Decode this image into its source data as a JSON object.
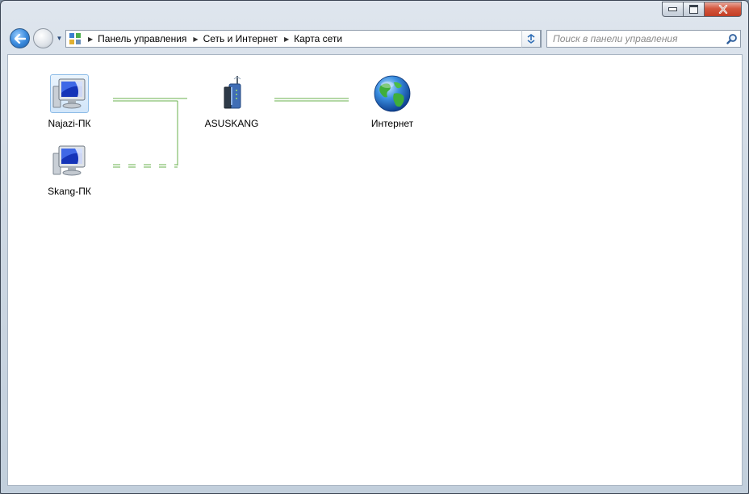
{
  "window": {
    "title": "",
    "buttons": {
      "minimize": "minimize",
      "maximize": "maximize",
      "close": "close"
    }
  },
  "nav": {
    "back_icon": "back-arrow-icon",
    "forward_icon": "forward-arrow-icon",
    "history_icon": "chevron-down-icon"
  },
  "address": {
    "breadcrumbs": [
      "Панель управления",
      "Сеть и Интернет",
      "Карта сети"
    ],
    "refresh_icon": "refresh-icon"
  },
  "search": {
    "placeholder": "Поиск в панели управления",
    "value": ""
  },
  "network_map": {
    "nodes": [
      {
        "label": "Najazi-ПК",
        "type": "computer",
        "selected": true
      },
      {
        "label": "Skang-ПК",
        "type": "computer",
        "selected": false
      },
      {
        "label": "ASUSKANG",
        "type": "router",
        "selected": false
      },
      {
        "label": "Интернет",
        "type": "internet",
        "selected": false
      }
    ],
    "connections": [
      {
        "from": "Najazi-ПК",
        "to": "ASUSKANG",
        "kind": "wired"
      },
      {
        "from": "Skang-ПК",
        "to": "ASUSKANG",
        "kind": "wireless"
      },
      {
        "from": "ASUSKANG",
        "to": "Интернет",
        "kind": "wired"
      }
    ],
    "line_color": "#6ab04c"
  }
}
